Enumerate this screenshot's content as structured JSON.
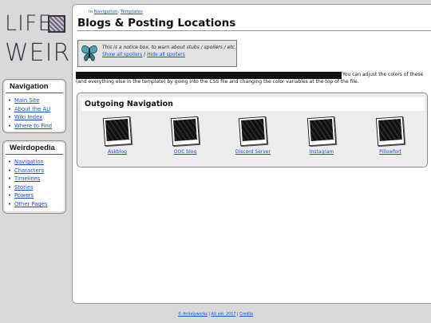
{
  "logo": {
    "line1": "LIFE",
    "line2": "WEIRD",
    "stamp_text": "AU"
  },
  "sidebar": {
    "navigation": {
      "title": "Navigation",
      "items": [
        {
          "label": "Main Site"
        },
        {
          "label": "About the AU"
        },
        {
          "label": "Wiki Index"
        },
        {
          "label": "Where to Find"
        }
      ]
    },
    "weirdopedia": {
      "title": "Weirdopedia",
      "items": [
        {
          "label": "Navigation"
        },
        {
          "label": "Characters"
        },
        {
          "label": "Timelines"
        },
        {
          "label": "Stories"
        },
        {
          "label": "Powers"
        },
        {
          "label": "Other Pages"
        }
      ]
    }
  },
  "main": {
    "breadcrumb": {
      "prefix": "in",
      "link1": "Navigation",
      "sep": ",",
      "link2": "Templates"
    },
    "title": "Blogs & Posting Locations",
    "notice": {
      "text": "This is a notice box, to warn about stubs / spoilers / etc.",
      "show_link": "Show all spoilers",
      "sep": "/",
      "hide_link": "Hide all spoilers"
    },
    "color_note_part1": "You can adjust the colors of these",
    "color_note_part2": "(and everything else in the template) by going into the CSS file and changing the color variables at the top of the file.",
    "outgoing": {
      "title": "Outgoing Navigation",
      "items": [
        {
          "label": "Askblog"
        },
        {
          "label": "OOC blog"
        },
        {
          "label": "Discord Server"
        },
        {
          "label": "Instagram"
        },
        {
          "label": "Pillowfort"
        }
      ]
    }
  },
  "footer": {
    "link1": "© finitelyworks",
    "sep1": "|",
    "link2": "AU est. 2017",
    "sep2": "|",
    "link3": "Credits"
  }
}
